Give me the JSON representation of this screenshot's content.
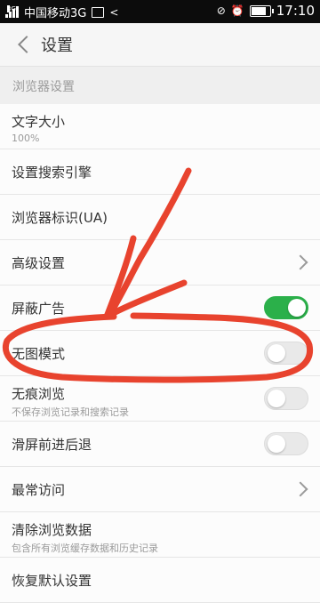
{
  "statusbar": {
    "carrier": "中国移动3G",
    "small_tag": "3G",
    "time": "17:10",
    "battery_level": 0.85
  },
  "header": {
    "title": "设置"
  },
  "section": {
    "label": "浏览器设置"
  },
  "items": [
    {
      "label": "文字大小",
      "sub": "100%",
      "control": "none"
    },
    {
      "label": "设置搜索引擎",
      "control": "none"
    },
    {
      "label": "浏览器标识(UA)",
      "control": "none"
    },
    {
      "label": "高级设置",
      "control": "chevron"
    },
    {
      "label": "屏蔽广告",
      "control": "toggle",
      "state": "on"
    },
    {
      "label": "无图模式",
      "control": "toggle",
      "state": "off"
    },
    {
      "label": "无痕浏览",
      "sub": "不保存浏览记录和搜索记录",
      "control": "toggle",
      "state": "off"
    },
    {
      "label": "滑屏前进后退",
      "control": "toggle",
      "state": "off"
    },
    {
      "label": "最常访问",
      "control": "chevron"
    },
    {
      "label": "清除浏览数据",
      "sub": "包含所有浏览缓存数据和历史记录",
      "control": "none"
    },
    {
      "label": "恢复默认设置",
      "control": "none"
    }
  ],
  "colors": {
    "toggle_on": "#2bb04a",
    "annotation": "#e8432e"
  }
}
